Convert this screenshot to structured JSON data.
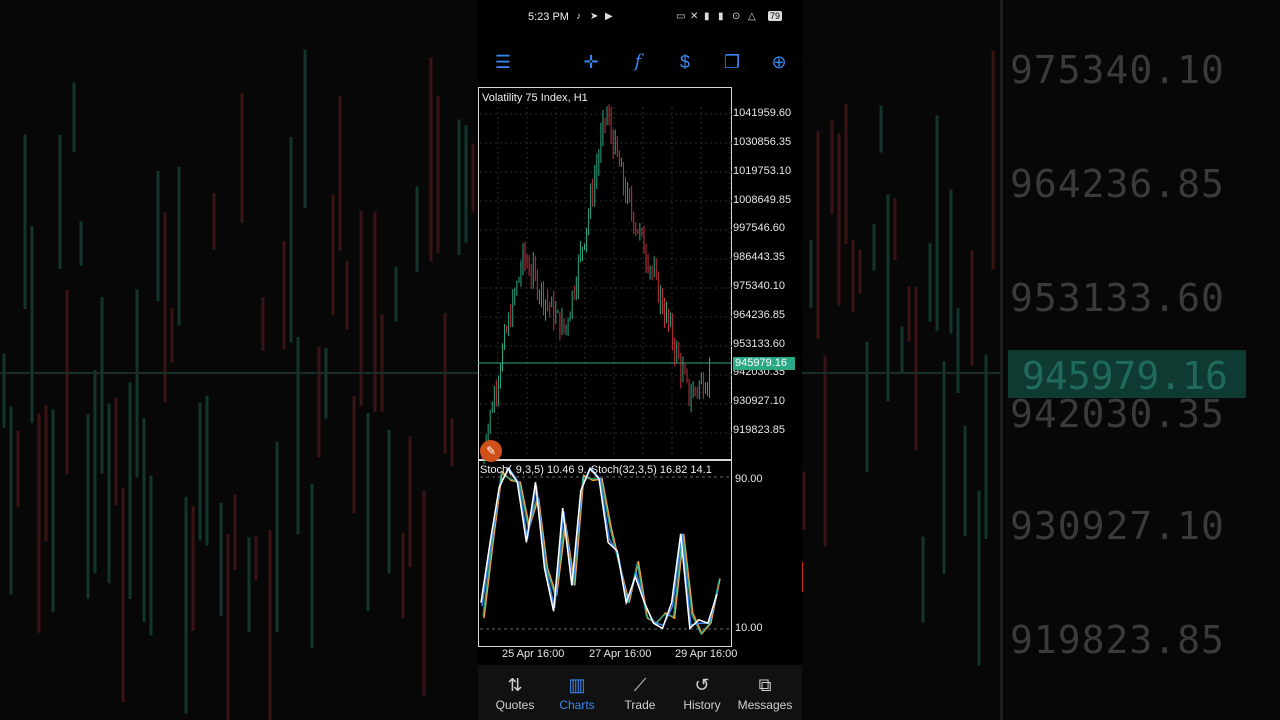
{
  "status_bar": {
    "time": "5:23 PM",
    "battery": "79"
  },
  "toolbar": {
    "items": [
      "menu-icon",
      "crosshair-icon",
      "function-icon",
      "dollar-icon",
      "windows-icon",
      "new-order-icon"
    ]
  },
  "chart": {
    "title": "Volatility 75 Index, H1",
    "price_labels": [
      "1041959.60",
      "1030856.35",
      "1019753.10",
      "1008649.85",
      "997546.60",
      "986443.35",
      "975340.10",
      "964236.85",
      "953133.60",
      "942030.35",
      "930927.10",
      "919823.85"
    ],
    "current_price": "945979.16",
    "indicator_labels": [
      "Stoch(",
      "9,3,5) 10.46 9.",
      "Stoch(32,3,5) 16.82 14.1"
    ],
    "indicator_levels": [
      "90.00",
      "10.00"
    ],
    "time_labels": [
      "25 Apr 16:00",
      "27 Apr 16:00",
      "29 Apr 16:00"
    ],
    "colors": {
      "bull": "#2aa885",
      "bear": "#c9323a",
      "current": "#2aa885"
    }
  },
  "chart_data": {
    "type": "line",
    "title": "Volatility 75 Index, H1",
    "x": [
      "25 Apr 16:00",
      "27 Apr 16:00",
      "29 Apr 16:00"
    ],
    "series": [
      {
        "values": [
          915000,
          955000,
          990000,
          975000,
          962000,
          1000000,
          1044000,
          1012000,
          990000,
          965000,
          938000,
          945979.16
        ]
      }
    ],
    "ylim": [
      915000,
      1046000
    ],
    "grid": true
  },
  "background": {
    "prices": [
      "975340.10",
      "964236.85",
      "953133.60",
      "942030.35",
      "930927.10",
      "919823.85"
    ],
    "highlight": "945979.16"
  },
  "bottom_nav": [
    {
      "label": "Quotes",
      "icon": "quotes-icon",
      "active": false
    },
    {
      "label": "Charts",
      "icon": "charts-icon",
      "active": true
    },
    {
      "label": "Trade",
      "icon": "trade-icon",
      "active": false
    },
    {
      "label": "History",
      "icon": "history-icon",
      "active": false
    },
    {
      "label": "Messages",
      "icon": "messages-icon",
      "active": false
    }
  ]
}
